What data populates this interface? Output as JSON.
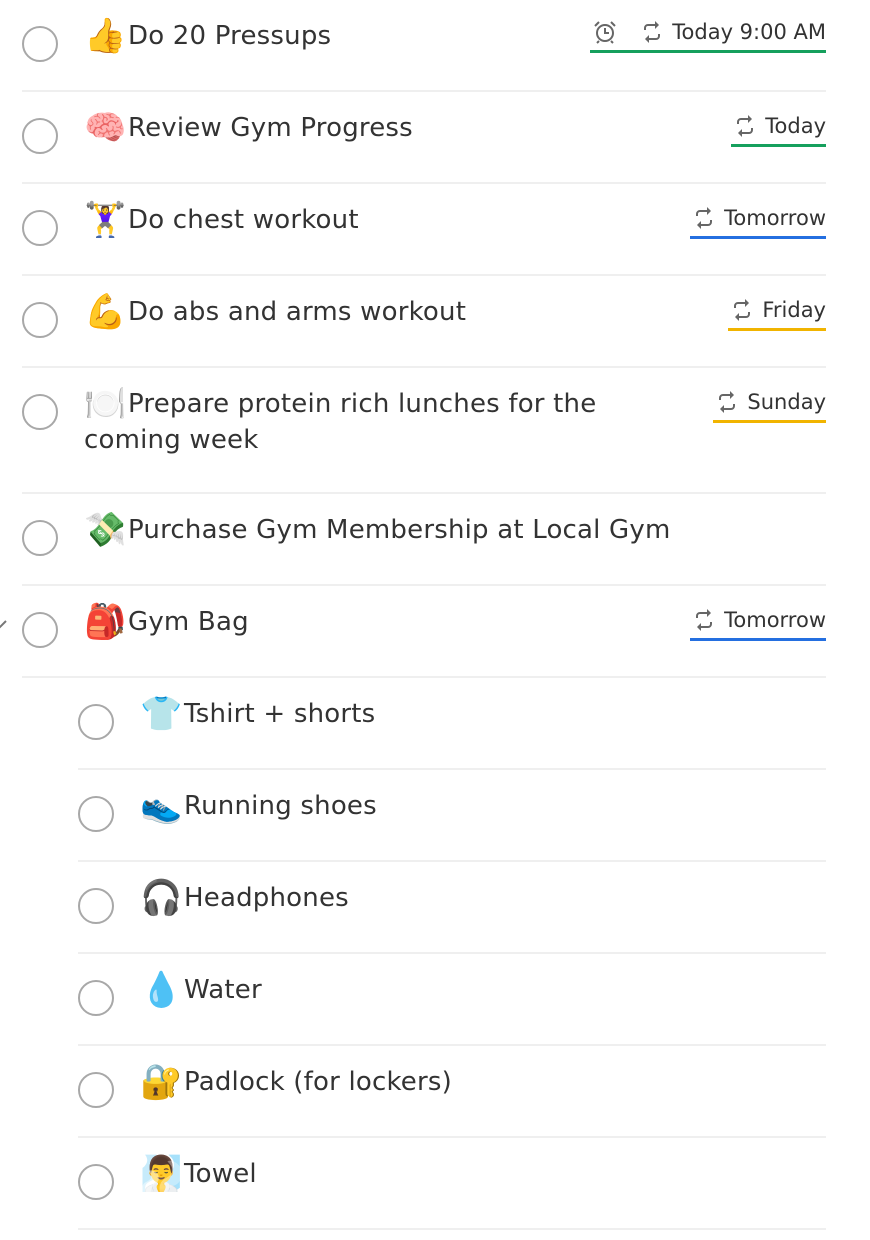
{
  "colors": {
    "today": "#058527",
    "tomorrow": "#246fe0",
    "later": "#eb8909",
    "week": "#f1b400"
  },
  "tasks": [
    {
      "emoji": "👍",
      "title": "Do 20 Pressups",
      "due": "Today 9:00 AM",
      "recurring": true,
      "reminder": true,
      "due_color": "#16a05d"
    },
    {
      "emoji": "🧠",
      "title": "Review Gym Progress",
      "due": "Today",
      "recurring": true,
      "reminder": false,
      "due_color": "#16a05d"
    },
    {
      "emoji": "🏋️‍♀️",
      "title": "Do chest workout",
      "due": "Tomorrow",
      "recurring": true,
      "reminder": false,
      "due_color": "#246fe0"
    },
    {
      "emoji": "💪",
      "title": "Do abs and arms workout",
      "due": "Friday",
      "recurring": true,
      "reminder": false,
      "due_color": "#f1b400"
    },
    {
      "emoji": "🍽️",
      "title": "Prepare protein rich lunches for the coming week",
      "due": "Sunday",
      "recurring": true,
      "reminder": false,
      "due_color": "#f1b400"
    },
    {
      "emoji": "💸",
      "title": "Purchase Gym Membership at Local Gym",
      "due": null
    },
    {
      "emoji": "🎒",
      "title": "Gym Bag",
      "due": "Tomorrow",
      "recurring": true,
      "reminder": false,
      "due_color": "#246fe0",
      "expanded": true
    }
  ],
  "subtasks": [
    {
      "emoji": "👕",
      "title": "Tshirt + shorts"
    },
    {
      "emoji": "👟",
      "title": "Running shoes"
    },
    {
      "emoji": "🎧",
      "title": "Headphones"
    },
    {
      "emoji": "💧",
      "title": "Water"
    },
    {
      "emoji": "🔐",
      "title": "Padlock (for lockers)"
    },
    {
      "emoji": "🧖‍♂️",
      "title": "Towel"
    }
  ]
}
